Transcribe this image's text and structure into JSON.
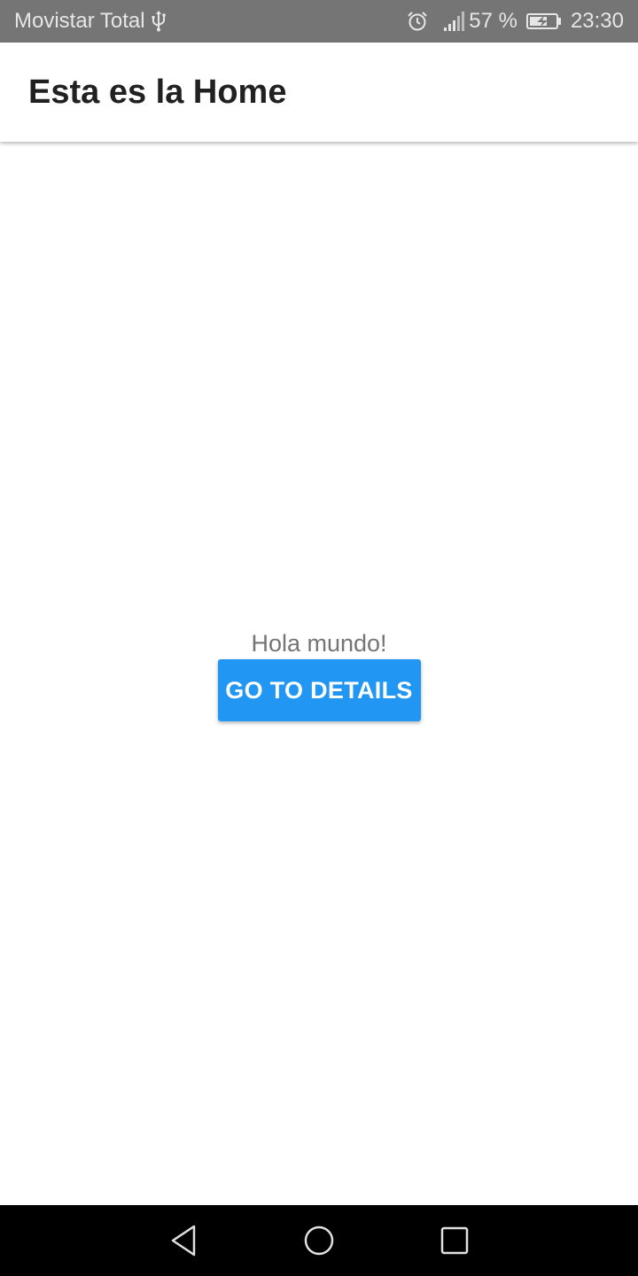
{
  "status_bar": {
    "carrier": "Movistar Total",
    "battery_percent": "57 %",
    "time": "23:30",
    "icons": [
      "usb-icon",
      "alarm-icon",
      "signal-icon",
      "battery-charging-icon"
    ]
  },
  "app_bar": {
    "title": "Esta es la Home"
  },
  "main": {
    "greeting": "Hola mundo!",
    "button_label": "GO TO DETAILS"
  },
  "nav_bar": {
    "icons": [
      "back-icon",
      "home-icon",
      "recents-icon"
    ]
  },
  "colors": {
    "accent": "#2196F3",
    "status_bar": "#757575",
    "nav_bar": "#000000"
  }
}
